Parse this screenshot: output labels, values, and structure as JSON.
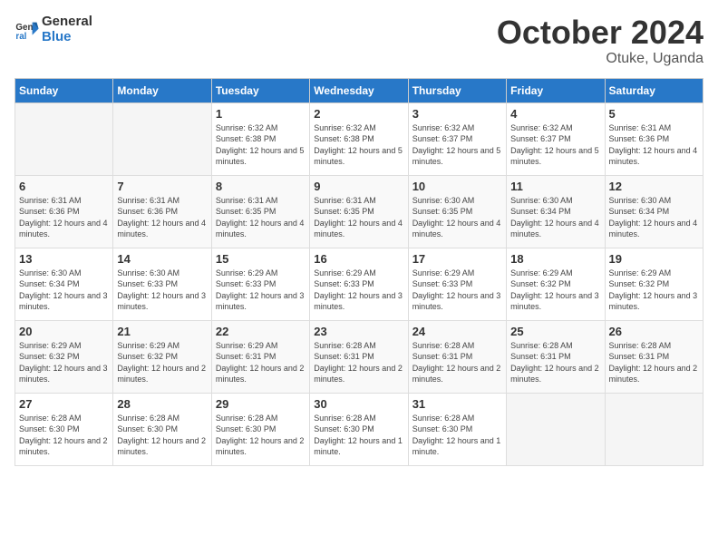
{
  "logo": {
    "text_general": "General",
    "text_blue": "Blue"
  },
  "header": {
    "month": "October 2024",
    "location": "Otuke, Uganda"
  },
  "days_of_week": [
    "Sunday",
    "Monday",
    "Tuesday",
    "Wednesday",
    "Thursday",
    "Friday",
    "Saturday"
  ],
  "weeks": [
    [
      {
        "day": "",
        "empty": true
      },
      {
        "day": "",
        "empty": true
      },
      {
        "day": "1",
        "sunrise": "6:32 AM",
        "sunset": "6:38 PM",
        "daylight": "12 hours and 5 minutes."
      },
      {
        "day": "2",
        "sunrise": "6:32 AM",
        "sunset": "6:38 PM",
        "daylight": "12 hours and 5 minutes."
      },
      {
        "day": "3",
        "sunrise": "6:32 AM",
        "sunset": "6:37 PM",
        "daylight": "12 hours and 5 minutes."
      },
      {
        "day": "4",
        "sunrise": "6:32 AM",
        "sunset": "6:37 PM",
        "daylight": "12 hours and 5 minutes."
      },
      {
        "day": "5",
        "sunrise": "6:31 AM",
        "sunset": "6:36 PM",
        "daylight": "12 hours and 4 minutes."
      }
    ],
    [
      {
        "day": "6",
        "sunrise": "6:31 AM",
        "sunset": "6:36 PM",
        "daylight": "12 hours and 4 minutes."
      },
      {
        "day": "7",
        "sunrise": "6:31 AM",
        "sunset": "6:36 PM",
        "daylight": "12 hours and 4 minutes."
      },
      {
        "day": "8",
        "sunrise": "6:31 AM",
        "sunset": "6:35 PM",
        "daylight": "12 hours and 4 minutes."
      },
      {
        "day": "9",
        "sunrise": "6:31 AM",
        "sunset": "6:35 PM",
        "daylight": "12 hours and 4 minutes."
      },
      {
        "day": "10",
        "sunrise": "6:30 AM",
        "sunset": "6:35 PM",
        "daylight": "12 hours and 4 minutes."
      },
      {
        "day": "11",
        "sunrise": "6:30 AM",
        "sunset": "6:34 PM",
        "daylight": "12 hours and 4 minutes."
      },
      {
        "day": "12",
        "sunrise": "6:30 AM",
        "sunset": "6:34 PM",
        "daylight": "12 hours and 4 minutes."
      }
    ],
    [
      {
        "day": "13",
        "sunrise": "6:30 AM",
        "sunset": "6:34 PM",
        "daylight": "12 hours and 3 minutes."
      },
      {
        "day": "14",
        "sunrise": "6:30 AM",
        "sunset": "6:33 PM",
        "daylight": "12 hours and 3 minutes."
      },
      {
        "day": "15",
        "sunrise": "6:29 AM",
        "sunset": "6:33 PM",
        "daylight": "12 hours and 3 minutes."
      },
      {
        "day": "16",
        "sunrise": "6:29 AM",
        "sunset": "6:33 PM",
        "daylight": "12 hours and 3 minutes."
      },
      {
        "day": "17",
        "sunrise": "6:29 AM",
        "sunset": "6:33 PM",
        "daylight": "12 hours and 3 minutes."
      },
      {
        "day": "18",
        "sunrise": "6:29 AM",
        "sunset": "6:32 PM",
        "daylight": "12 hours and 3 minutes."
      },
      {
        "day": "19",
        "sunrise": "6:29 AM",
        "sunset": "6:32 PM",
        "daylight": "12 hours and 3 minutes."
      }
    ],
    [
      {
        "day": "20",
        "sunrise": "6:29 AM",
        "sunset": "6:32 PM",
        "daylight": "12 hours and 3 minutes."
      },
      {
        "day": "21",
        "sunrise": "6:29 AM",
        "sunset": "6:32 PM",
        "daylight": "12 hours and 2 minutes."
      },
      {
        "day": "22",
        "sunrise": "6:29 AM",
        "sunset": "6:31 PM",
        "daylight": "12 hours and 2 minutes."
      },
      {
        "day": "23",
        "sunrise": "6:28 AM",
        "sunset": "6:31 PM",
        "daylight": "12 hours and 2 minutes."
      },
      {
        "day": "24",
        "sunrise": "6:28 AM",
        "sunset": "6:31 PM",
        "daylight": "12 hours and 2 minutes."
      },
      {
        "day": "25",
        "sunrise": "6:28 AM",
        "sunset": "6:31 PM",
        "daylight": "12 hours and 2 minutes."
      },
      {
        "day": "26",
        "sunrise": "6:28 AM",
        "sunset": "6:31 PM",
        "daylight": "12 hours and 2 minutes."
      }
    ],
    [
      {
        "day": "27",
        "sunrise": "6:28 AM",
        "sunset": "6:30 PM",
        "daylight": "12 hours and 2 minutes."
      },
      {
        "day": "28",
        "sunrise": "6:28 AM",
        "sunset": "6:30 PM",
        "daylight": "12 hours and 2 minutes."
      },
      {
        "day": "29",
        "sunrise": "6:28 AM",
        "sunset": "6:30 PM",
        "daylight": "12 hours and 2 minutes."
      },
      {
        "day": "30",
        "sunrise": "6:28 AM",
        "sunset": "6:30 PM",
        "daylight": "12 hours and 1 minute."
      },
      {
        "day": "31",
        "sunrise": "6:28 AM",
        "sunset": "6:30 PM",
        "daylight": "12 hours and 1 minute."
      },
      {
        "day": "",
        "empty": true
      },
      {
        "day": "",
        "empty": true
      }
    ]
  ],
  "labels": {
    "sunrise_prefix": "Sunrise: ",
    "sunset_prefix": "Sunset: ",
    "daylight_prefix": "Daylight: "
  }
}
